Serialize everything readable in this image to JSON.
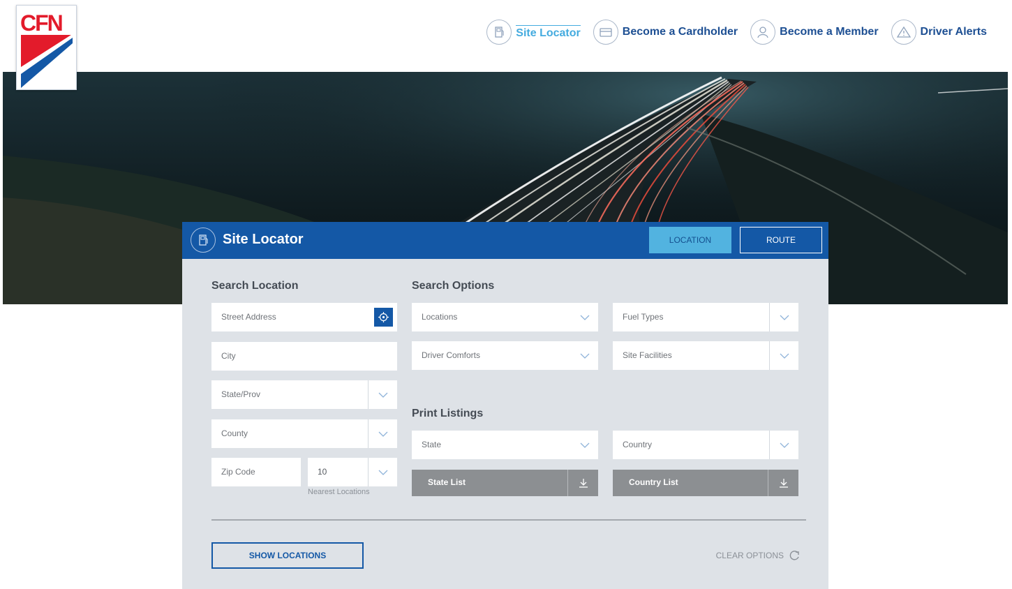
{
  "brand": {
    "logo_text": "CFN",
    "accent": "#1458a6",
    "light_accent": "#44abdf",
    "logo_red": "#e31b2b"
  },
  "nav": {
    "items": [
      {
        "label": "Site Locator",
        "icon": "fuel-pump-icon",
        "active": true
      },
      {
        "label": "Become a Cardholder",
        "icon": "card-icon",
        "active": false
      },
      {
        "label": "Become a Member",
        "icon": "user-icon",
        "active": false
      },
      {
        "label": "Driver Alerts",
        "icon": "warning-icon",
        "active": false
      }
    ]
  },
  "panel": {
    "title": "Site Locator",
    "title_icon": "fuel-pump-icon",
    "tabs": {
      "location": "LOCATION",
      "route": "ROUTE"
    },
    "search_location": {
      "heading": "Search Location",
      "street_placeholder": "Street Address",
      "city_placeholder": "City",
      "state_placeholder": "State/Prov",
      "county_placeholder": "County",
      "zip_placeholder": "Zip Code",
      "nearest_value": "10",
      "nearest_caption": "Nearest Locations"
    },
    "search_options": {
      "heading": "Search Options",
      "locations": "Locations",
      "fuel_types": "Fuel Types",
      "driver_comforts": "Driver Comforts",
      "site_facilities": "Site Facilities"
    },
    "print_listings": {
      "heading": "Print Listings",
      "state": "State",
      "country": "Country",
      "state_list": "State List",
      "country_list": "Country List"
    },
    "show_locations": "SHOW LOCATIONS",
    "clear_options": "CLEAR OPTIONS"
  }
}
